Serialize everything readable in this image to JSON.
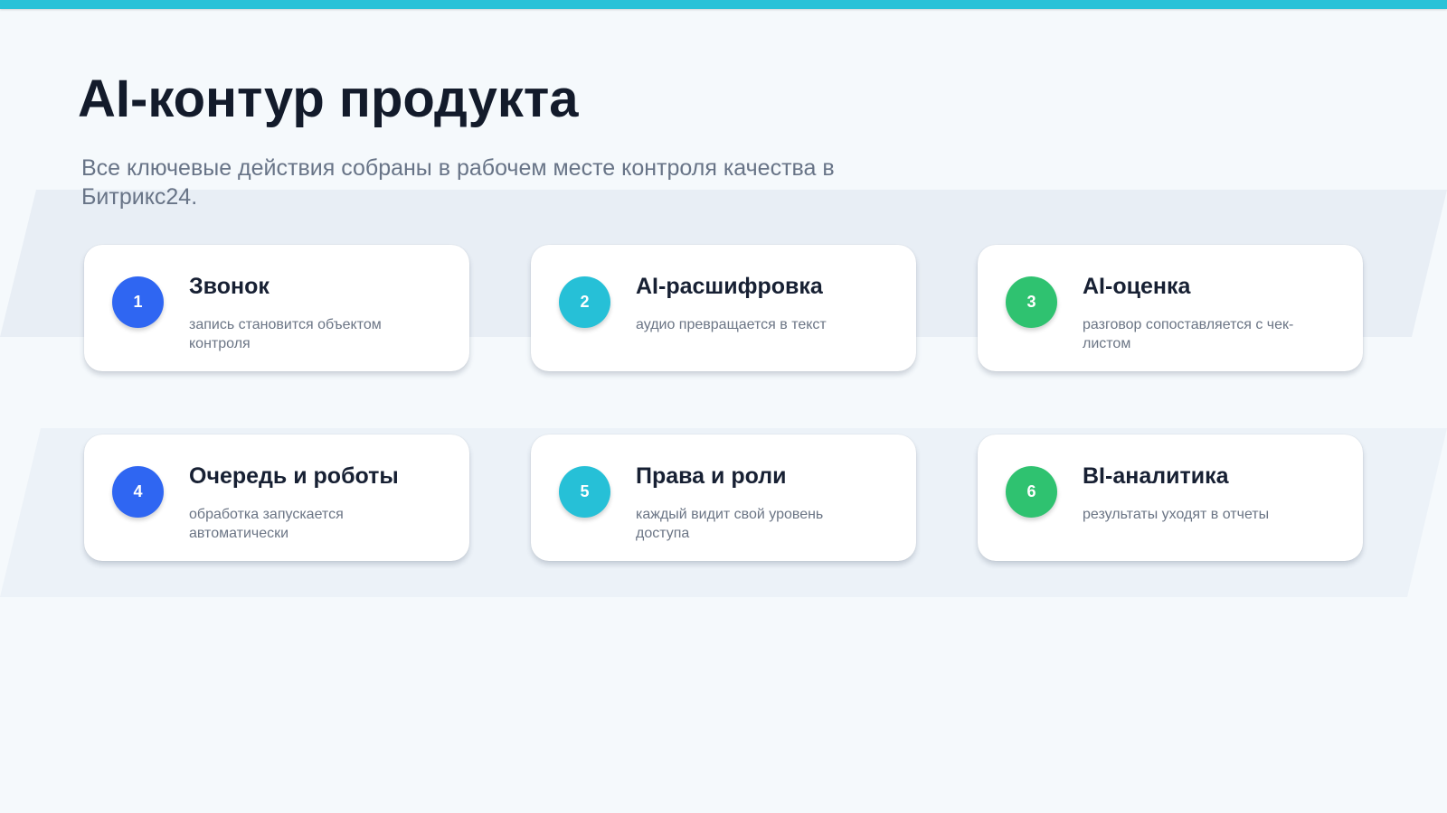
{
  "header": {
    "title": "AI-контур продукта",
    "subtitle": "Все ключевые действия собраны в рабочем месте контроля качества в Битрикс24."
  },
  "colors": {
    "accent_bar": "#28c2d8",
    "blue": "#2f66f2",
    "teal": "#26c0d7",
    "green": "#2fc270"
  },
  "cards": [
    {
      "number": "1",
      "title": "Звонок",
      "description": "запись становится объектом контроля",
      "color": "#2f66f2"
    },
    {
      "number": "2",
      "title": "AI-расшифровка",
      "description": "аудио превращается в текст",
      "color": "#26c0d7"
    },
    {
      "number": "3",
      "title": "AI-оценка",
      "description": "разговор сопоставляется с чек-листом",
      "color": "#2fc270"
    },
    {
      "number": "4",
      "title": "Очередь и роботы",
      "description": "обработка запускается автоматически",
      "color": "#2f66f2"
    },
    {
      "number": "5",
      "title": "Права и роли",
      "description": "каждый видит свой уровень доступа",
      "color": "#26c0d7"
    },
    {
      "number": "6",
      "title": "BI-аналитика",
      "description": "результаты уходят в отчеты",
      "color": "#2fc270"
    }
  ]
}
